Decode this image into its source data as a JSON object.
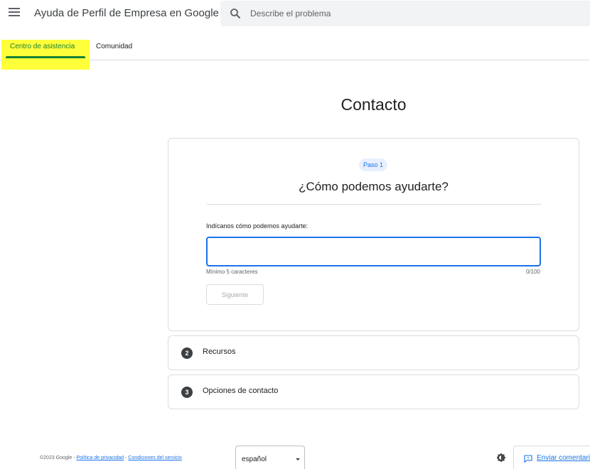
{
  "header": {
    "menu_icon": "hamburger-menu-icon",
    "title": "Ayuda de Perfil de Empresa en Google",
    "search": {
      "icon": "search-icon",
      "placeholder": "Describe el problema"
    }
  },
  "tabs": [
    {
      "label": "Centro de asistencia",
      "active": true
    },
    {
      "label": "Comunidad",
      "active": false
    }
  ],
  "highlight_color": "#ffff3a",
  "accent_color": "#188038",
  "page": {
    "title": "Contacto"
  },
  "steps": {
    "step1": {
      "badge": "Paso 1",
      "heading": "¿Cómo podemos ayudarte?",
      "field_label": "Indícanos cómo podemos ayudarte:",
      "input_value": "",
      "helper": "Mínimo 5 caracteres",
      "counter": "0/100",
      "next_label": "Siguiente"
    },
    "step2": {
      "number": "2",
      "label": "Recursos"
    },
    "step3": {
      "number": "3",
      "label": "Opciones de contacto"
    }
  },
  "footer": {
    "copyright": "©2023 Google",
    "separator": " - ",
    "privacy_link": "Política de privacidad",
    "terms_link": "Condiciones del servicio",
    "language": "español",
    "theme_icon": "brightness-icon",
    "feedback_icon": "feedback-icon",
    "feedback_label": "Enviar comentarios"
  }
}
